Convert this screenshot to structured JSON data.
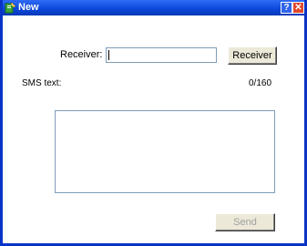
{
  "window": {
    "title": "New",
    "help_label": "?",
    "close_label": "✕"
  },
  "form": {
    "receiver_label": "Receiver:",
    "receiver_value": "",
    "receiver_button": "Receiver",
    "sms_label": "SMS text:",
    "char_counter": "0/160",
    "sms_value": "",
    "send_button": "Send"
  },
  "colors": {
    "titlebar": "#0a46d8",
    "border": "#0a33c8",
    "close": "#e0462a"
  },
  "icons": {
    "app": "phone-book-icon"
  }
}
